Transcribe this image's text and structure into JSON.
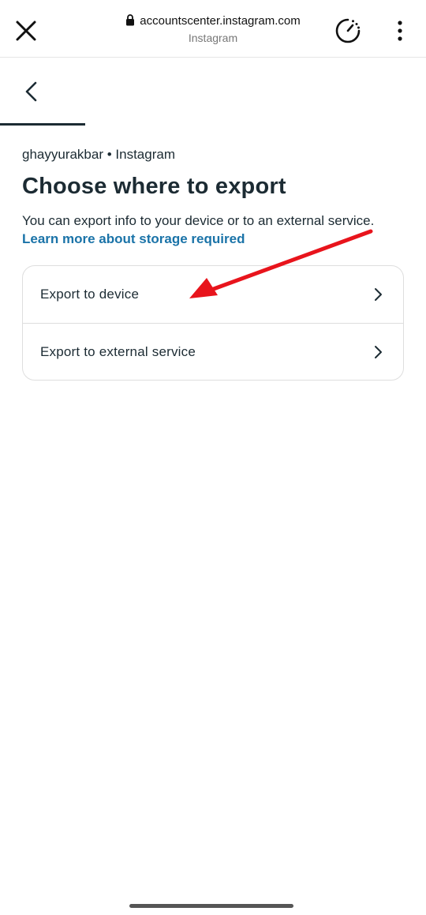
{
  "browser": {
    "url": "accountscenter.instagram.com",
    "site_name": "Instagram"
  },
  "content": {
    "account_label": "ghayyurakbar • Instagram",
    "title": "Choose where to export",
    "description": "You can export info to your device or to an external service. ",
    "learn_more_link": "Learn more about storage required",
    "options": [
      {
        "label": "Export to device"
      },
      {
        "label": "Export to external service"
      }
    ]
  },
  "colors": {
    "text": "#1c2b33",
    "link": "#1a73a8",
    "annotation_arrow": "#e8141c"
  },
  "icons": [
    "close-icon",
    "lock-icon",
    "timer-icon",
    "more-vertical-icon",
    "back-arrow-icon",
    "chevron-right-icon"
  ]
}
